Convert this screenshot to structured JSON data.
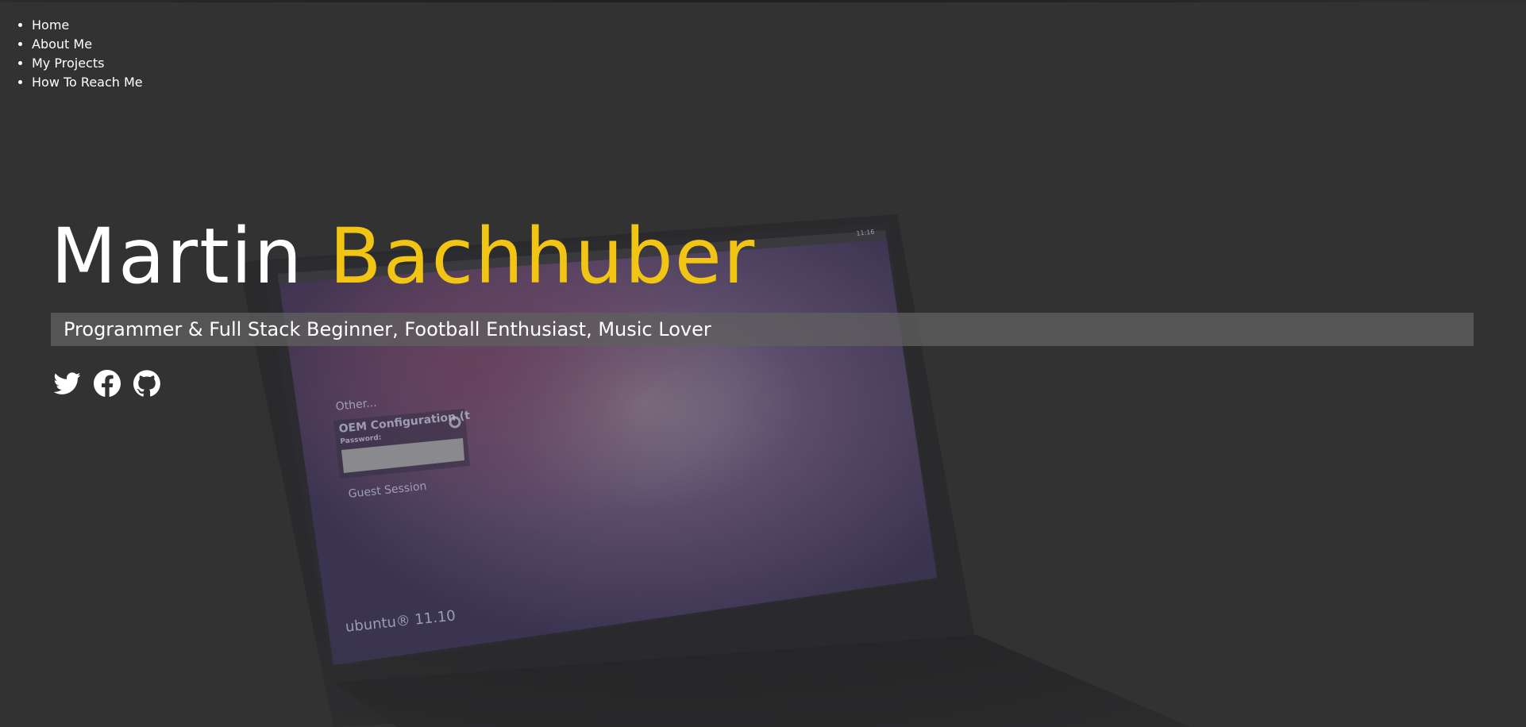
{
  "nav": {
    "items": [
      {
        "label": "Home"
      },
      {
        "label": "About Me"
      },
      {
        "label": "My Projects"
      },
      {
        "label": "How To Reach Me"
      }
    ]
  },
  "hero": {
    "first_name": "Martin",
    "last_name": "Bachhuber",
    "tagline": "Programmer & Full Stack Beginner, Football Enthusiast, Music Lover"
  },
  "social": [
    {
      "icon": "twitter-icon"
    },
    {
      "icon": "facebook-icon"
    },
    {
      "icon": "github-icon"
    }
  ],
  "background_screen": {
    "other_label": "Other...",
    "oem_label": "OEM Configuration (t",
    "password_label": "Password:",
    "guest_label": "Guest Session",
    "os_label": "ubuntu® 11.10",
    "clock": "11:16"
  },
  "colors": {
    "background": "#323232",
    "accent": "#f2c515",
    "text": "#ffffff",
    "tagline_bar": "#5f5f5f"
  }
}
